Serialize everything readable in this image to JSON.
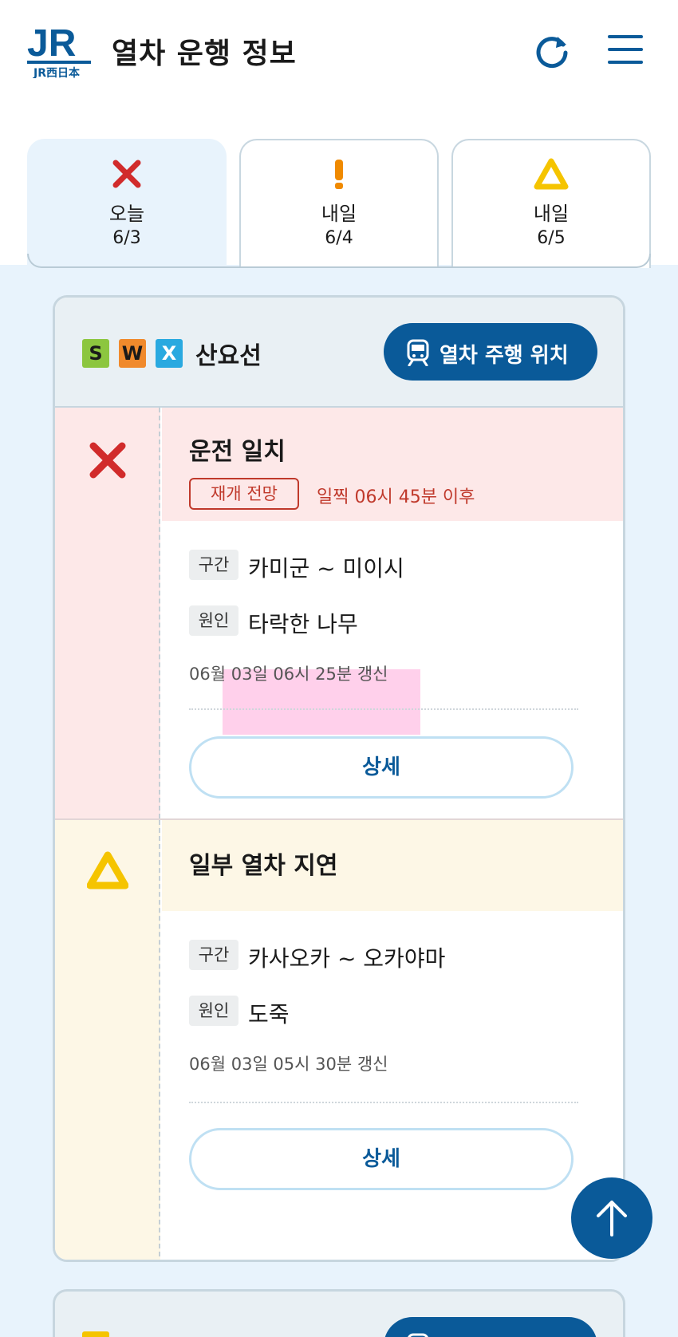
{
  "header": {
    "title": "열차 운행 정보",
    "logo_text": "JR",
    "logo_sub": "JR西日本"
  },
  "tabs": [
    {
      "label": "오늘",
      "date": "6/3",
      "status": "cross-icon",
      "active": true
    },
    {
      "label": "내일",
      "date": "6/4",
      "status": "exclamation-icon",
      "active": false
    },
    {
      "label": "내일",
      "date": "6/5",
      "status": "triangle-icon",
      "active": false
    }
  ],
  "lines": [
    {
      "badges": [
        {
          "letter": "S",
          "color": "#8cc63f"
        },
        {
          "letter": "W",
          "color": "#f08a2c"
        },
        {
          "letter": "X",
          "color": "#29a9e0"
        }
      ],
      "name": "산요선",
      "position_button": "열차 주행 위치",
      "sections": [
        {
          "status": "운전 일치",
          "status_icon": "cross-icon",
          "resume_label": "재개 전망",
          "resume_time": "일찍 06시 45분 이후",
          "section_tag": "구간",
          "section_value": "카미군 ~ 미이시",
          "cause_tag": "원인",
          "cause_value": "타락한 나무",
          "updated": "06월 03일 06시 25분 갱신",
          "detail_button": "상세"
        },
        {
          "status": "일부 열차 지연",
          "status_icon": "triangle-icon",
          "section_tag": "구간",
          "section_value": "카사오카 ~ 오카야마",
          "cause_tag": "원인",
          "cause_value": "도죽",
          "updated": "06월 03일 05시 30분 갱신",
          "detail_button": "상세"
        }
      ]
    },
    {
      "badges": [
        {
          "letter": "",
          "color": "#f5c400"
        }
      ],
      "name": "",
      "position_button": ""
    }
  ],
  "colors": {
    "brand_blue": "#0a5a99",
    "suspended_bg": "#fde8e8",
    "delay_bg": "#fdf7e6",
    "cross_red": "#d12b2b",
    "warn_yellow": "#f5c400",
    "warn_orange": "#f08a00"
  }
}
